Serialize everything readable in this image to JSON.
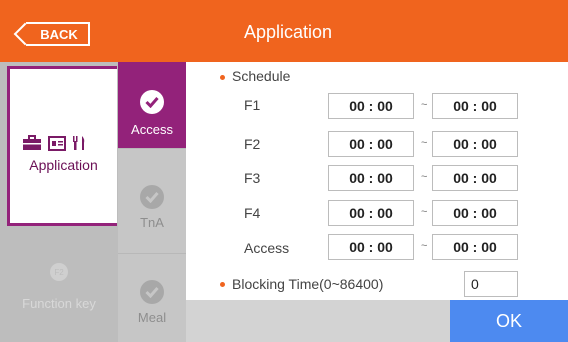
{
  "header": {
    "back_label": "BACK",
    "title": "Application"
  },
  "left_menu": {
    "application_label": "Application",
    "function_key_label": "Function key",
    "function_key_badge": "F2"
  },
  "tabs": [
    {
      "label": "Access",
      "active": true
    },
    {
      "label": "TnA",
      "active": false
    },
    {
      "label": "Meal",
      "active": false
    }
  ],
  "schedule": {
    "heading": "Schedule",
    "separator": "~",
    "rows": [
      {
        "label": "F1",
        "from": "00 : 00",
        "to": "00 : 00"
      },
      {
        "label": "F2",
        "from": "00 : 00",
        "to": "00 : 00"
      },
      {
        "label": "F3",
        "from": "00 : 00",
        "to": "00 : 00"
      },
      {
        "label": "F4",
        "from": "00 : 00",
        "to": "00 : 00"
      },
      {
        "label": "Access",
        "from": "00 : 00",
        "to": "00 : 00"
      }
    ]
  },
  "blocking": {
    "label": "Blocking Time(0~86400)",
    "value": "0"
  },
  "ok_label": "OK",
  "colors": {
    "header": "#f0641e",
    "active_tab": "#93227a",
    "ok": "#4d8af0"
  }
}
